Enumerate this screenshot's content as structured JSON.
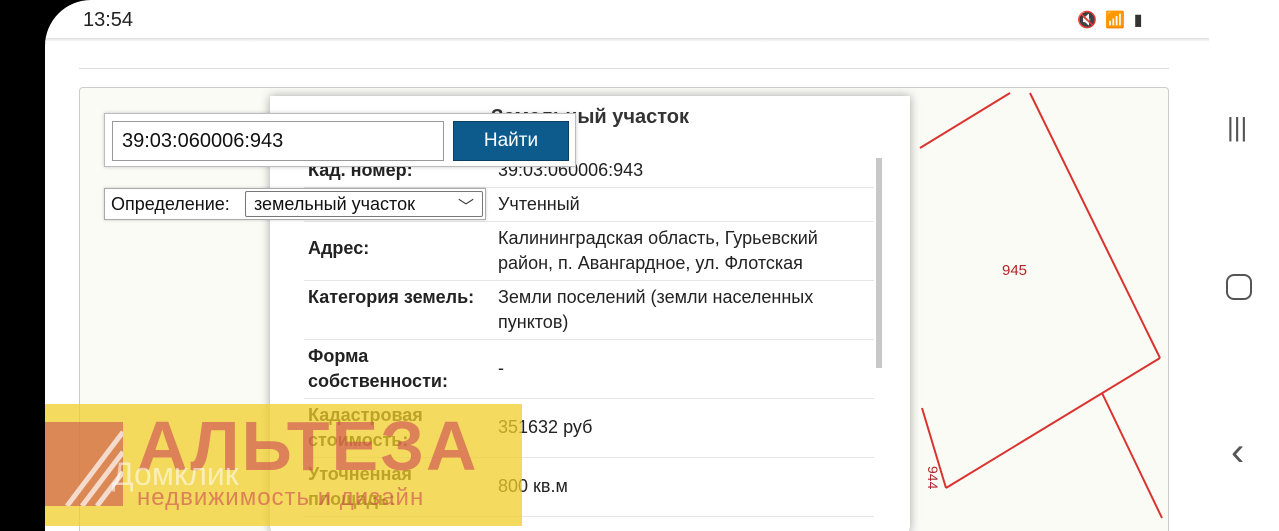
{
  "status_bar": {
    "time": "13:54",
    "icons": "🔇 📶 ▮"
  },
  "search": {
    "value": "39:03:060006:943",
    "button_label": "Найти"
  },
  "definition": {
    "label": "Определение:",
    "selected": "земельный участок"
  },
  "popup": {
    "title": "Земельный участок",
    "rows": [
      {
        "key": "Кад. номер:",
        "value": "39:03:060006:943"
      },
      {
        "key": "",
        "value": "Учтенный"
      },
      {
        "key": "Адрес:",
        "value": "Калининградская область, Гурьевский район, п. Авангардное, ул. Флотская"
      },
      {
        "key": "Категория земель:",
        "value": "Земли поселений (земли населенных пунктов)"
      },
      {
        "key": "Форма собственности:",
        "value": "-"
      },
      {
        "key": "Кадастровая стоимость:",
        "value": "351632 руб"
      },
      {
        "key": "Уточненная площадь:",
        "value": "800 кв.м"
      }
    ]
  },
  "map": {
    "labels": [
      "945",
      "944"
    ],
    "line_color": "#d9332f"
  },
  "watermark": {
    "brand": "АЛЬТЕЗА",
    "tagline": "недвижимость и дизайн",
    "domclick": "Домклик"
  },
  "nav": {
    "recents": "|||",
    "home": "○",
    "back": "‹"
  }
}
